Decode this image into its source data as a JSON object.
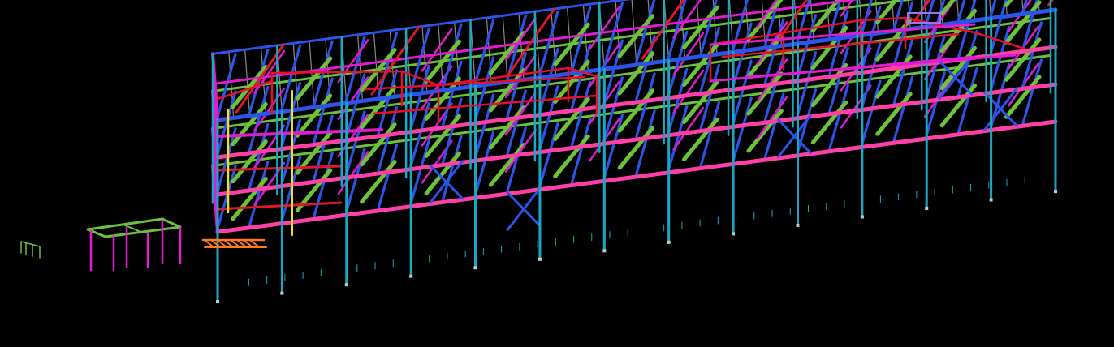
{
  "viewport": {
    "background": "#000000"
  },
  "model": {
    "description_hidden": "",
    "colors": {
      "column": "#19a8c4",
      "beam_blue": "#2a55e8",
      "beam_magenta": "#e01cd0",
      "beam_pink": "#ff3fa8",
      "beam_red": "#e01828",
      "beam_green": "#6cc23a",
      "deck_grey": "#8a8a8a",
      "bracing_violet": "#a070f0",
      "yellow": "#f0e020",
      "orange": "#ff7a1a",
      "rail_red": "#e8102a",
      "base_plate": "#c8c8c8"
    },
    "floor_levels": 4,
    "bays": 13
  }
}
